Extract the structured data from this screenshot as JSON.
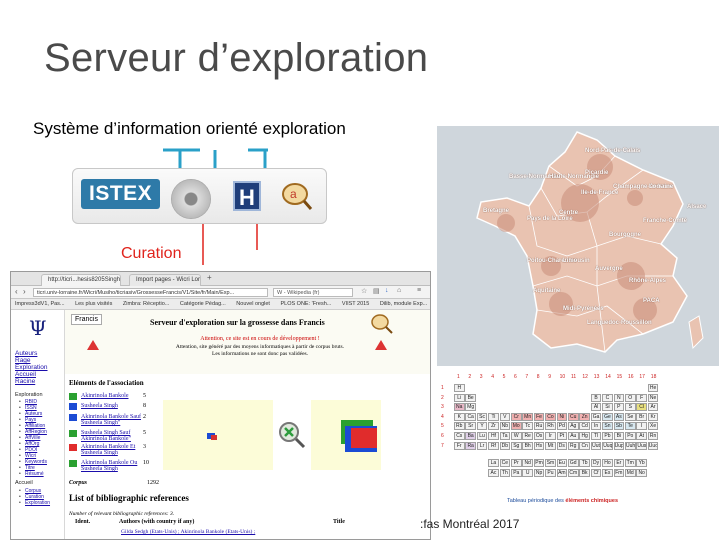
{
  "slide": {
    "title": "Serveur d’exploration",
    "subtitle": "Système d’information orienté exploration",
    "curation_label": "Curation",
    "footer": ":fas Montréal 2017"
  },
  "pipeline": {
    "logo": "ISTEX",
    "h_label": "H",
    "icons": [
      "disc-icon",
      "h-database-icon",
      "magnifier-icon"
    ]
  },
  "colors": {
    "accent_red": "#e0231c",
    "arrow_blue": "#2aa0c8",
    "istex_blue": "#2e7aa8"
  },
  "browser": {
    "tabs": [
      "http://ticri...hesis8205Singh",
      "Import pages - Wicri Lorr..."
    ],
    "url": "ticri.univ-lorraine.fr/Wicri/Musiho/ticriasiv/GrossesseFrancis/V1/Site/fr/Main/Exp...",
    "search_placeholder": "W - Wikipedia (fr)",
    "bookmarks": [
      "Impress3dV1, Pas...",
      "Les plus visités",
      "Zimbra: Réceptio...",
      "Catégorie Pédag...",
      "Nouvel onglet",
      "PLOS ONE: 'Fresh...",
      "VIIST 2015",
      "Dilib, module Exp..."
    ]
  },
  "nav": {
    "links": [
      "Auteurs",
      "Rage",
      "Exploration",
      "Accueil",
      "Racine"
    ],
    "section1": "Exploration",
    "sublinks1": [
      "RBID",
      "ISSN",
      "Auteurs",
      "Pays",
      "Affiliation",
      "AffRegion",
      "AffVille",
      "AffOrg",
      "PDOI",
      "Wicri",
      "Keywords",
      "Titre",
      "Résumé"
    ],
    "section2": "Accueil",
    "sublinks2": [
      "Corpus",
      "Curation",
      "Exploration"
    ]
  },
  "page": {
    "source_tag": "Francis",
    "title": "Serveur d'exploration sur la grossesse dans Francis",
    "attention": "Attention, ce site est en cours de développement !",
    "notice1": "Attention, site généré par des moyens informatiques à partir de corpus bruts.",
    "notice2": "Les informations ne sont donc pas validées.",
    "assoc_title": "Eléments de l'association",
    "assoc_rows": [
      {
        "name": "Akinrinola Bankole",
        "count": "5"
      },
      {
        "name": "Susheela Singh",
        "count": "8"
      },
      {
        "name": "Akinrinola Bankole Sauf Susheela Singh\"",
        "count": "2"
      },
      {
        "name": "Susheela Singh Sauf Akinrinola Bankole\"",
        "count": "5"
      },
      {
        "name": "Akinrinola Bankole Et Susheela Singh",
        "count": "3"
      },
      {
        "name": "Akinrinola Bankole Ou Susheela Singh",
        "count": "10"
      }
    ],
    "corpus_label": "Corpus",
    "corpus_count": "1292",
    "biblio_title": "List of bibliographic references",
    "biblio_count": "Number of relevant bibliographic references: 3.",
    "columns": [
      "Ident.",
      "Authors (with country if any)",
      "Title"
    ],
    "first_row": "Gilda Sedgh (Etats-Unis) ; Akinrinola Bankole (Etats-Unis) ;"
  },
  "map": {
    "regions": [
      "Nord-Pas-de-Calais",
      "Basse-Normandie",
      "Haute-Normandie",
      "Picardie",
      "Ile-de-France",
      "Champagne-Ardenne",
      "Lorraine",
      "Alsace",
      "Bretagne",
      "Pays de la Loire",
      "Centre",
      "Bourgogne",
      "Franche-Comté",
      "Poitou-Charentes",
      "Limousin",
      "Auvergne",
      "Rhône-Alpes",
      "Aquitaine",
      "Midi-Pyrénées",
      "PACA",
      "Languedoc-Roussillon"
    ]
  },
  "periodic": {
    "caption_prefix": "Tableau périodique des",
    "caption_emph": "éléments chimiques",
    "groups": [
      "1",
      "2",
      "3",
      "4",
      "5",
      "6",
      "7",
      "8",
      "9",
      "10",
      "11",
      "12",
      "13",
      "14",
      "15",
      "16",
      "17",
      "18"
    ],
    "periods": [
      "1",
      "2",
      "3",
      "4",
      "5",
      "6",
      "7"
    ],
    "rows": [
      [
        "H",
        "",
        "",
        "",
        "",
        "",
        "",
        "",
        "",
        "",
        "",
        "",
        "",
        "",
        "",
        "",
        "",
        "He"
      ],
      [
        "Li",
        "Be",
        "",
        "",
        "",
        "",
        "",
        "",
        "",
        "",
        "",
        "",
        "B",
        "C",
        "N",
        "O",
        "F",
        "Ne"
      ],
      [
        "Na",
        "Mg",
        "",
        "",
        "",
        "",
        "",
        "",
        "",
        "",
        "",
        "",
        "Al",
        "Si",
        "P",
        "S",
        "Cl",
        "Ar"
      ],
      [
        "K",
        "Ca",
        "Sc",
        "Ti",
        "V",
        "Cr",
        "Mn",
        "Fe",
        "Co",
        "Ni",
        "Cu",
        "Zn",
        "Ga",
        "Ge",
        "As",
        "Se",
        "Br",
        "Kr"
      ],
      [
        "Rb",
        "Sr",
        "Y",
        "Zr",
        "Nb",
        "Mo",
        "Tc",
        "Ru",
        "Rh",
        "Pd",
        "Ag",
        "Cd",
        "In",
        "Sn",
        "Sb",
        "Te",
        "I",
        "Xe"
      ],
      [
        "Cs",
        "Ba",
        "*",
        "Lu",
        "Hf",
        "Ta",
        "W",
        "Re",
        "Os",
        "Ir",
        "Pt",
        "Au",
        "Hg",
        "Tl",
        "Pb",
        "Bi",
        "Po",
        "At",
        "Rn"
      ],
      [
        "Fr",
        "Ra",
        "*",
        "Lr",
        "Rf",
        "Db",
        "Sg",
        "Bh",
        "Hs",
        "Mt",
        "Ds",
        "Rg",
        "Cn",
        "Uut",
        "Uuq",
        "Uup",
        "Uuh",
        "Uus",
        "Uuo"
      ]
    ],
    "lanth": [
      "La",
      "Ce",
      "Pr",
      "Nd",
      "Pm",
      "Sm",
      "Eu",
      "Gd",
      "Tb",
      "Dy",
      "Ho",
      "Er",
      "Tm",
      "Yb"
    ],
    "actin": [
      "Ac",
      "Th",
      "Pa",
      "U",
      "Np",
      "Pu",
      "Am",
      "Cm",
      "Bk",
      "Cf",
      "Es",
      "Fm",
      "Md",
      "No"
    ]
  }
}
